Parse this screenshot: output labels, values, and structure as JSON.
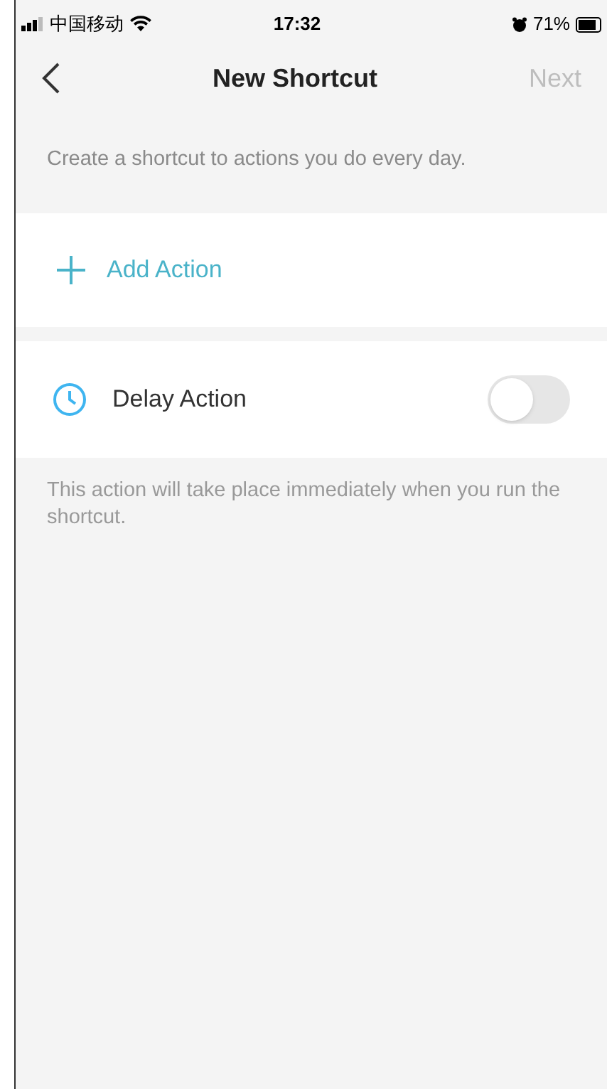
{
  "status_bar": {
    "carrier": "中国移动",
    "time": "17:32",
    "battery": "71%"
  },
  "header": {
    "title": "New Shortcut",
    "next": {
      "label": "Next",
      "disabled": true
    }
  },
  "description": "Create a shortcut to actions you do every day.",
  "add_action": {
    "label": "Add Action"
  },
  "delay_action": {
    "label": "Delay Action",
    "on": false
  },
  "note": "This action will take place immediately when you run the shortcut."
}
